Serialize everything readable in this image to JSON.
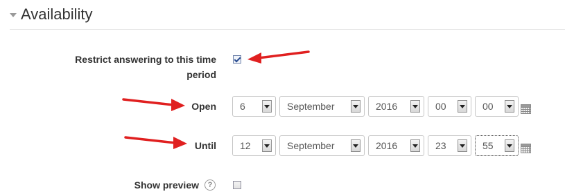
{
  "section": {
    "title": "Availability"
  },
  "restrict": {
    "label": "Restrict answering to this time period",
    "label_line1": "Restrict answering to this time",
    "label_line2": "period",
    "checked": true
  },
  "open": {
    "label": "Open",
    "day": "6",
    "month": "September",
    "year": "2016",
    "hour": "00",
    "minute": "00"
  },
  "until": {
    "label": "Until",
    "day": "12",
    "month": "September",
    "year": "2016",
    "hour": "23",
    "minute": "55"
  },
  "preview": {
    "label": "Show preview",
    "help_glyph": "?",
    "checked": false
  },
  "colors": {
    "annotation_arrow": "#e02020",
    "heading_text": "#333333"
  }
}
